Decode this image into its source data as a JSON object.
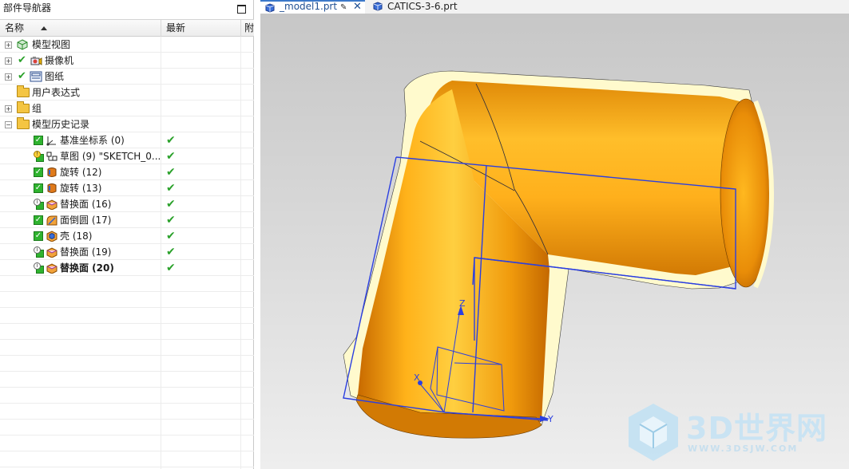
{
  "navigator": {
    "title": "部件导航器",
    "columns": {
      "name": "名称",
      "latest": "最新",
      "extra": "附"
    },
    "top_rows": [
      {
        "label": "模型视图",
        "icon": "model-views-icon"
      },
      {
        "label": "摄像机",
        "icon": "camera-icon"
      },
      {
        "label": "图纸",
        "icon": "drawing-icon"
      },
      {
        "label": "用户表达式",
        "icon": "folder-icon"
      },
      {
        "label": "组",
        "icon": "folder-icon"
      },
      {
        "label": "模型历史记录",
        "icon": "folder-open-icon"
      }
    ],
    "history": [
      {
        "label": "基准坐标系 (0)",
        "icon": "datum-csys-icon",
        "latest": "✔"
      },
      {
        "label": "草图 (9) \"SKETCH_0...",
        "icon": "sketch-icon",
        "latest": "✔"
      },
      {
        "label": "旋转 (12)",
        "icon": "revolve-icon",
        "latest": "✔"
      },
      {
        "label": "旋转 (13)",
        "icon": "revolve-icon",
        "latest": "✔"
      },
      {
        "label": "替换面 (16)",
        "icon": "replace-face-icon",
        "latest": "✔"
      },
      {
        "label": "面倒圆 (17)",
        "icon": "face-blend-icon",
        "latest": "✔"
      },
      {
        "label": "壳 (18)",
        "icon": "shell-icon",
        "latest": "✔"
      },
      {
        "label": "替换面 (19)",
        "icon": "replace-face-icon",
        "latest": "✔"
      },
      {
        "label": "替换面 (20)",
        "icon": "replace-face-icon",
        "latest": "✔"
      }
    ]
  },
  "tabs": [
    {
      "label": "_model1.prt",
      "active": true
    },
    {
      "label": "CATICS-3-6.prt",
      "active": false
    }
  ],
  "viewport": {
    "axis_labels": {
      "x": "X",
      "y": "Y",
      "z": "Z"
    },
    "watermark": {
      "text": "3D世界网",
      "url": "WWW.3DSJW.COM"
    }
  },
  "colors": {
    "part_orange": "#f0a012",
    "part_cream": "#fffacd",
    "selection_blue": "#2b3fe0",
    "check_green": "#2aa12a",
    "tab_accent": "#3b78c9"
  }
}
